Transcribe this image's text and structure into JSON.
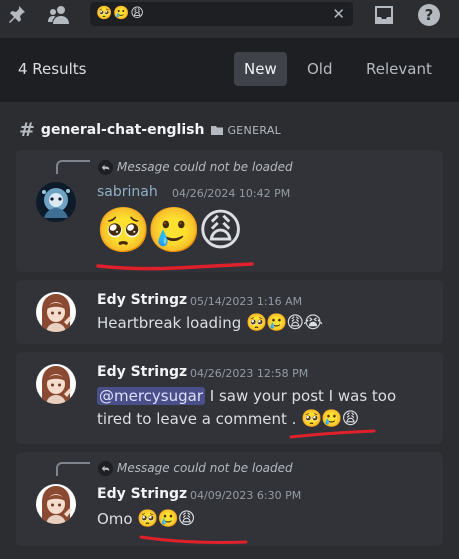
{
  "search": {
    "query": "🥺🥲😩",
    "clear_icon": "✕"
  },
  "topbar_icons": [
    "pin-icon",
    "members-icon",
    "inbox-icon",
    "help-icon"
  ],
  "results": {
    "count_label": "4 Results"
  },
  "sort_tabs": [
    {
      "label": "New",
      "active": true
    },
    {
      "label": "Old",
      "active": false
    },
    {
      "label": "Relevant",
      "active": false
    }
  ],
  "channel": {
    "name": "general-chat-english",
    "category": "GENERAL"
  },
  "messages": [
    {
      "reply_text": "Message could not be loaded",
      "author": "sabrinah",
      "timestamp": "04/26/2024 10:42 PM",
      "content": "🥺🥲😩"
    },
    {
      "author": "Edy Stringz",
      "timestamp": "05/14/2023 1:16 AM",
      "text": "Heartbreak loading ",
      "emojis": "🥺🥲😩😭"
    },
    {
      "author": "Edy Stringz",
      "timestamp": "04/26/2023 12:58 PM",
      "mention": "@mercysugar",
      "text_line1": " I saw your post I was too",
      "text_line2": "tired to leave a comment .",
      "emojis": "🥺🥲😩"
    },
    {
      "reply_text": "Message could not be loaded",
      "author": "Edy Stringz",
      "timestamp": "04/09/2023 6:30 PM",
      "text": "Omo ",
      "emojis": "🥺🥲😩"
    }
  ],
  "colors": {
    "background": "#2b2d31",
    "card": "#313338",
    "header": "#1e1f22",
    "accent_red": "#e0202a",
    "mention_bg": "#4a4f8a"
  }
}
